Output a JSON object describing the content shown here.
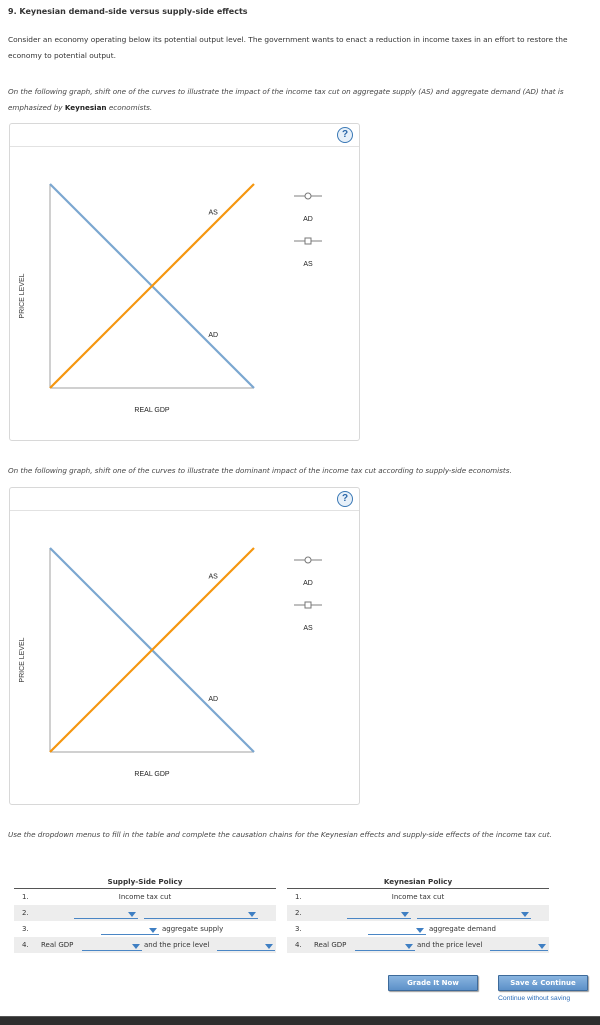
{
  "question": {
    "title": "9. Keynesian demand-side versus supply-side effects",
    "intro": "Consider an economy operating below its potential output level. The government wants to enact a reduction in income taxes in an effort to restore the economy to potential output.",
    "instruction1_pre": "On the following graph, shift one of the curves to illustrate the impact of the income tax cut on aggregate supply (AS) and aggregate demand (AD) that is emphasized by ",
    "instruction1_bold": "Keynesian",
    "instruction1_post": " economists.",
    "instruction2": "On the following graph, shift one of the curves to illustrate the dominant impact of the income tax cut according to supply-side economists.",
    "instruction3": "Use the dropdown menus to fill in the table and complete the causation chains for the Keynesian effects and supply-side effects of the income tax cut."
  },
  "colors": {
    "ad_curve": "#7ba7d0",
    "as_curve": "#f5960f",
    "axis": "#a0a0a0",
    "dropdown": "#3f7fc3",
    "button": "#6a9bd0",
    "link": "#2b6cb8"
  },
  "chart_data": [
    {
      "type": "line",
      "title": "Keynesian graph",
      "xlabel": "REAL GDP",
      "ylabel": "PRICE LEVEL",
      "xlim": [
        0,
        1
      ],
      "ylim": [
        0,
        1
      ],
      "grid": false,
      "series": [
        {
          "name": "AD",
          "points": [
            [
              0,
              1
            ],
            [
              1,
              0
            ]
          ],
          "label": "AD",
          "label_at": [
            0.8,
            0.25
          ]
        },
        {
          "name": "AS",
          "points": [
            [
              0,
              0
            ],
            [
              1,
              1
            ]
          ],
          "label": "AS",
          "label_at": [
            0.8,
            0.85
          ]
        }
      ],
      "legend_tools": [
        {
          "name": "AD",
          "marker": "circle"
        },
        {
          "name": "AS",
          "marker": "square"
        }
      ],
      "help_label": "?"
    },
    {
      "type": "line",
      "title": "Supply-side graph",
      "xlabel": "REAL GDP",
      "ylabel": "PRICE LEVEL",
      "xlim": [
        0,
        1
      ],
      "ylim": [
        0,
        1
      ],
      "grid": false,
      "series": [
        {
          "name": "AD",
          "points": [
            [
              0,
              1
            ],
            [
              1,
              0
            ]
          ],
          "label": "AD",
          "label_at": [
            0.8,
            0.25
          ]
        },
        {
          "name": "AS",
          "points": [
            [
              0,
              0
            ],
            [
              1,
              1
            ]
          ],
          "label": "AS",
          "label_at": [
            0.8,
            0.85
          ]
        }
      ],
      "legend_tools": [
        {
          "name": "AD",
          "marker": "circle"
        },
        {
          "name": "AS",
          "marker": "square"
        }
      ],
      "help_label": "?"
    }
  ],
  "table": {
    "supply_side": {
      "header": "Supply-Side Policy",
      "row1_num": "1.",
      "row1_text": "Income tax cut",
      "row2_num": "2.",
      "row2_dd1": "",
      "row2_dd2": "",
      "row3_num": "3.",
      "row3_dd": "",
      "row3_text": "aggregate supply",
      "row4_num": "4.",
      "row4_pre": "Real GDP",
      "row4_dd1": "",
      "row4_mid": "and the price level",
      "row4_dd2": ""
    },
    "keynesian": {
      "header": "Keynesian Policy",
      "row1_num": "1.",
      "row1_text": "Income tax cut",
      "row2_num": "2.",
      "row2_dd1": "",
      "row2_dd2": "",
      "row3_num": "3.",
      "row3_dd": "",
      "row3_text": "aggregate demand",
      "row4_num": "4.",
      "row4_pre": "Real GDP",
      "row4_dd1": "",
      "row4_mid": "and the price level",
      "row4_dd2": ""
    }
  },
  "actions": {
    "grade_label": "Grade It Now",
    "save_label": "Save & Continue",
    "continue_link": "Continue without saving"
  }
}
